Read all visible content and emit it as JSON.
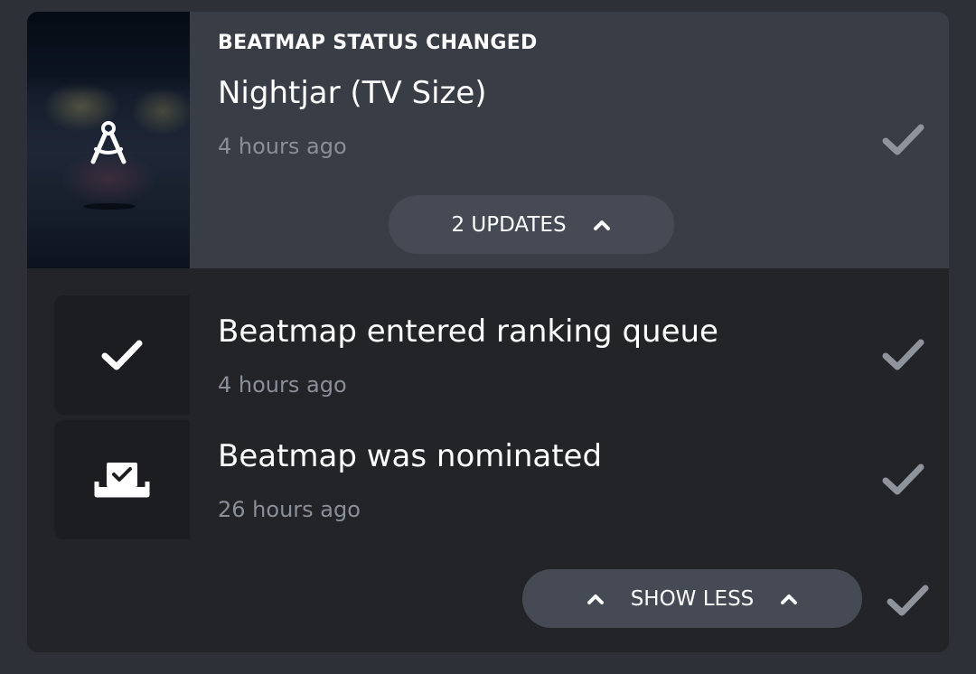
{
  "notification": {
    "category": "BEATMAP STATUS CHANGED",
    "title": "Nightjar (TV Size)",
    "time": "4 hours ago",
    "cover_icon": "compass-drafting-icon",
    "updates_button": {
      "label": "2 UPDATES",
      "icon": "chevron-up-icon"
    }
  },
  "updates": [
    {
      "text": "Beatmap entered ranking queue",
      "time": "4 hours ago",
      "icon": "check-icon"
    },
    {
      "text": "Beatmap was nominated",
      "time": "26 hours ago",
      "icon": "ballot-box-icon"
    }
  ],
  "show_less_button": {
    "label": "SHOW LESS",
    "icon": "chevron-up-icon"
  },
  "mark_read_icon": "check-icon",
  "colors": {
    "background": "#2d3036",
    "panel": "#222428",
    "header": "#393d45",
    "pill": "#454a54",
    "muted_text": "#8a8f99",
    "mark_read": "#8e939c"
  }
}
